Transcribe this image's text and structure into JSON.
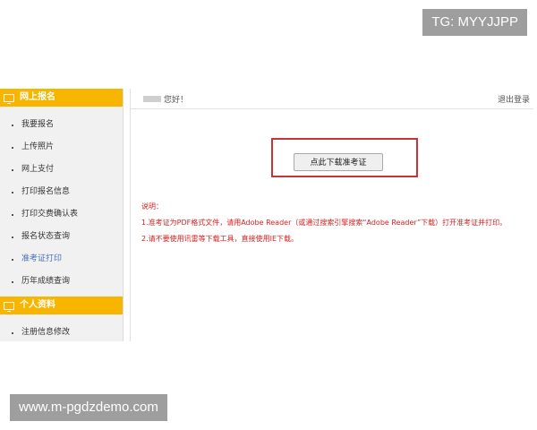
{
  "watermarks": {
    "top": "TG: MYYJJPP",
    "bottom": "www.m-pgdzdemo.com"
  },
  "sidebar": {
    "section1": {
      "title": "网上报名",
      "icon": "monitor-icon",
      "items": [
        "我要报名",
        "上传照片",
        "网上支付",
        "打印报名信息",
        "打印交费确认表",
        "报名状态查询",
        "准考证打印",
        "历年成绩查询"
      ]
    },
    "section2": {
      "title": "个人资料",
      "icon": "id-card-icon",
      "items": [
        "注册信息修改"
      ]
    },
    "active_item": "准考证打印"
  },
  "topbar": {
    "greeting": "您好！",
    "logout": "退出登录"
  },
  "main": {
    "download_button": "点此下载准考证",
    "notes_title": "说明：",
    "notes": [
      "1.准考证为PDF格式文件，请用Adobe Reader（或通过搜索引擎搜索“Adobe Reader”下载）打开准考证并打印。",
      "2.请不要使用讯雷等下载工具，直接使用IE下载。"
    ]
  },
  "colors": {
    "header_orange": "#f7b500",
    "notes_red": "#d91f1f",
    "frame_red": "#c9333a",
    "active_blue": "#4a6fb5"
  }
}
